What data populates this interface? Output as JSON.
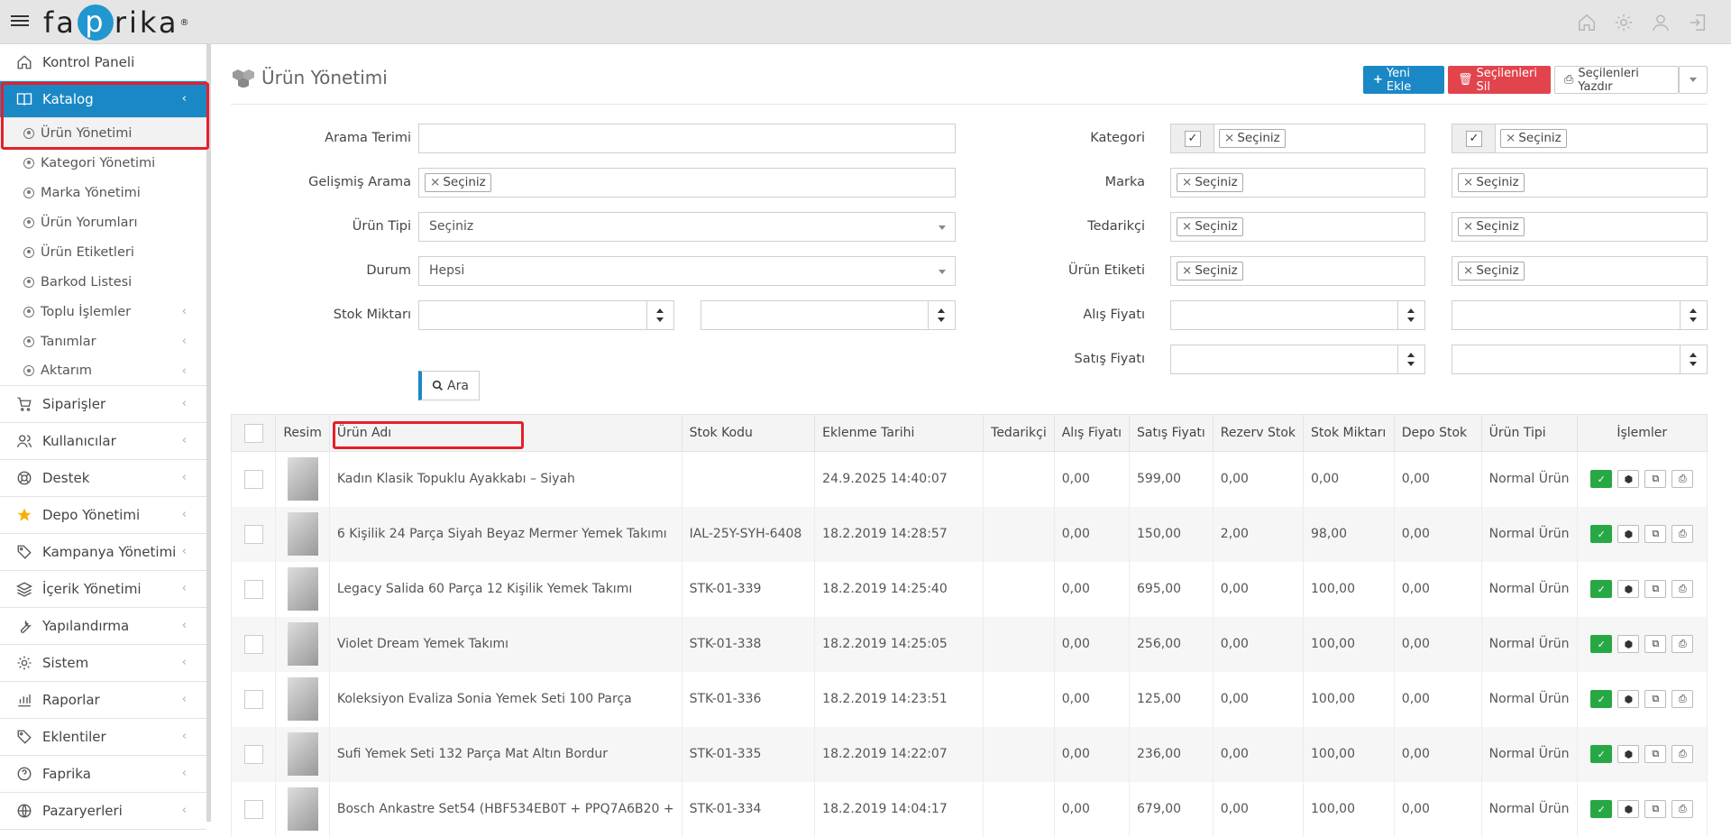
{
  "header": {
    "logo_prefix": "fa",
    "logo_mid": "p",
    "logo_suffix": "rika",
    "logo_reg": "®"
  },
  "sidebar": {
    "items": [
      {
        "label": "Kontrol Paneli",
        "icon": "home-icon"
      },
      {
        "label": "Katalog",
        "icon": "book-icon",
        "active": true
      },
      {
        "label": "Siparişler",
        "icon": "cart-icon"
      },
      {
        "label": "Kullanıcılar",
        "icon": "users-icon"
      },
      {
        "label": "Destek",
        "icon": "lifebuoy-icon"
      },
      {
        "label": "Depo Yönetimi",
        "icon": "star-icon"
      },
      {
        "label": "Kampanya Yönetimi",
        "icon": "tag-icon"
      },
      {
        "label": "İçerik Yönetimi",
        "icon": "layers-icon"
      },
      {
        "label": "Yapılandırma",
        "icon": "wrench-icon"
      },
      {
        "label": "Sistem",
        "icon": "gear-icon"
      },
      {
        "label": "Raporlar",
        "icon": "bar-chart-icon"
      },
      {
        "label": "Eklentiler",
        "icon": "tag-icon"
      },
      {
        "label": "Faprika",
        "icon": "question-icon"
      },
      {
        "label": "Pazaryerleri",
        "icon": "globe-icon"
      }
    ],
    "sub": [
      "Ürün Yönetimi",
      "Kategori Yönetimi",
      "Marka Yönetimi",
      "Ürün Yorumları",
      "Ürün Etiketleri",
      "Barkod Listesi",
      "Toplu İşlemler",
      "Tanımlar",
      "Aktarım"
    ]
  },
  "page": {
    "title": "Ürün Yönetimi",
    "btn_new": "Yeni Ekle",
    "btn_delete": "Seçilenleri Sil",
    "btn_print": "Seçilenleri Yazdır"
  },
  "filters": {
    "arama_terimi": "Arama Terimi",
    "gelismis_arama": "Gelişmiş Arama",
    "urun_tipi": "Ürün Tipi",
    "urun_tipi_value": "Seçiniz",
    "durum": "Durum",
    "durum_value": "Hepsi",
    "stok_miktari": "Stok Miktarı",
    "kategori": "Kategori",
    "marka": "Marka",
    "tedarikci": "Tedarikçi",
    "urun_etiketi": "Ürün Etiketi",
    "alis_fiyati": "Alış Fiyatı",
    "satis_fiyati": "Satış Fiyatı",
    "tag_value": "Seçiniz",
    "tag_x": "×",
    "search_btn": "Ara"
  },
  "table": {
    "headers": [
      "Resim",
      "Ürün Adı",
      "Stok Kodu",
      "Eklenme Tarihi",
      "Tedarikçi",
      "Alış Fiyatı",
      "Satış Fiyatı",
      "Rezerv Stok",
      "Stok Miktarı",
      "Depo Stok",
      "Ürün Tipi",
      "İşlemler"
    ],
    "rows": [
      {
        "name": "Kadın Klasik Topuklu Ayakkabı – Siyah",
        "code": "",
        "date": "24.9.2025 14:40:07",
        "supplier": "",
        "buy": "0,00",
        "sell": "599,00",
        "reserve": "0,00",
        "stock": "0,00",
        "depot": "0,00",
        "type": "Normal Ürün"
      },
      {
        "name": "6 Kişilik 24 Parça Siyah Beyaz Mermer Yemek Takımı",
        "code": "IAL-25Y-SYH-6408",
        "date": "18.2.2019 14:28:57",
        "supplier": "",
        "buy": "0,00",
        "sell": "150,00",
        "reserve": "2,00",
        "stock": "98,00",
        "depot": "0,00",
        "type": "Normal Ürün"
      },
      {
        "name": "Legacy Salida 60 Parça 12 Kişilik Yemek Takımı",
        "code": "STK-01-339",
        "date": "18.2.2019 14:25:40",
        "supplier": "",
        "buy": "0,00",
        "sell": "695,00",
        "reserve": "0,00",
        "stock": "100,00",
        "depot": "0,00",
        "type": "Normal Ürün"
      },
      {
        "name": "Violet Dream Yemek Takımı",
        "code": "STK-01-338",
        "date": "18.2.2019 14:25:05",
        "supplier": "",
        "buy": "0,00",
        "sell": "256,00",
        "reserve": "0,00",
        "stock": "100,00",
        "depot": "0,00",
        "type": "Normal Ürün"
      },
      {
        "name": "Koleksiyon Evaliza Sonia Yemek Seti 100 Parça",
        "code": "STK-01-336",
        "date": "18.2.2019 14:23:51",
        "supplier": "",
        "buy": "0,00",
        "sell": "125,00",
        "reserve": "0,00",
        "stock": "100,00",
        "depot": "0,00",
        "type": "Normal Ürün"
      },
      {
        "name": "Sufi Yemek Seti 132 Parça Mat Altın Bordur",
        "code": "STK-01-335",
        "date": "18.2.2019 14:22:07",
        "supplier": "",
        "buy": "0,00",
        "sell": "236,00",
        "reserve": "0,00",
        "stock": "100,00",
        "depot": "0,00",
        "type": "Normal Ürün"
      },
      {
        "name": "Bosch Ankastre Set54 (HBF534EB0T + PPQ7A6B20 +",
        "code": "STK-01-334",
        "date": "18.2.2019 14:04:17",
        "supplier": "",
        "buy": "0,00",
        "sell": "679,00",
        "reserve": "0,00",
        "stock": "100,00",
        "depot": "0,00",
        "type": "Normal Ürün"
      }
    ]
  },
  "colors": {
    "accent": "#1b88c6",
    "danger": "#e2444d",
    "success": "#27a844",
    "highlight": "#e4202a"
  }
}
